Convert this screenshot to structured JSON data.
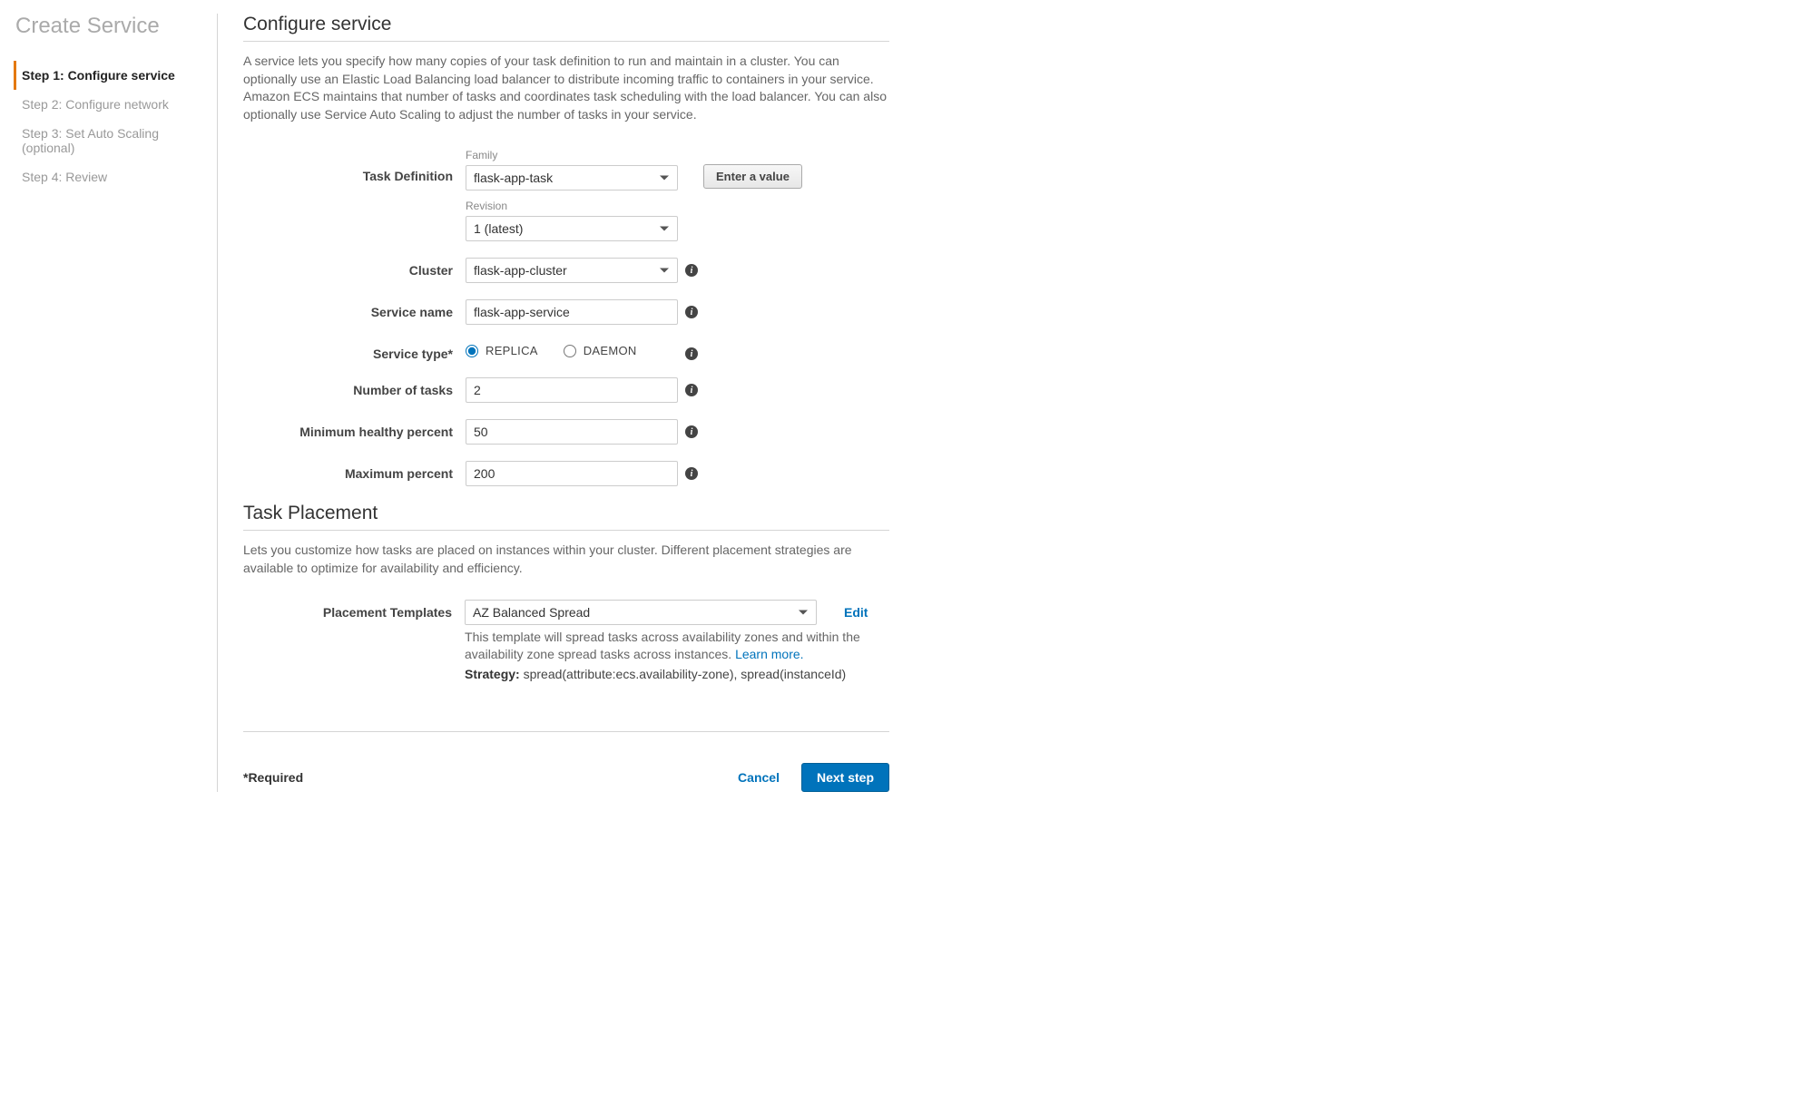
{
  "sidebar": {
    "title": "Create Service",
    "steps": [
      {
        "label": "Step 1: Configure service",
        "active": true
      },
      {
        "label": "Step 2: Configure network",
        "active": false
      },
      {
        "label": "Step 3: Set Auto Scaling (optional)",
        "active": false
      },
      {
        "label": "Step 4: Review",
        "active": false
      }
    ]
  },
  "configure": {
    "title": "Configure service",
    "description": "A service lets you specify how many copies of your task definition to run and maintain in a cluster. You can optionally use an Elastic Load Balancing load balancer to distribute incoming traffic to containers in your service. Amazon ECS maintains that number of tasks and coordinates task scheduling with the load balancer. You can also optionally use Service Auto Scaling to adjust the number of tasks in your service.",
    "task_definition": {
      "label": "Task Definition",
      "family_label": "Family",
      "family_value": "flask-app-task",
      "revision_label": "Revision",
      "revision_value": "1 (latest)",
      "enter_value_btn": "Enter a value"
    },
    "cluster": {
      "label": "Cluster",
      "value": "flask-app-cluster"
    },
    "service_name": {
      "label": "Service name",
      "value": "flask-app-service"
    },
    "service_type": {
      "label": "Service type*",
      "options": [
        {
          "label": "REPLICA",
          "checked": true
        },
        {
          "label": "DAEMON",
          "checked": false
        }
      ]
    },
    "number_of_tasks": {
      "label": "Number of tasks",
      "value": "2"
    },
    "min_healthy": {
      "label": "Minimum healthy percent",
      "value": "50"
    },
    "max_percent": {
      "label": "Maximum percent",
      "value": "200"
    }
  },
  "placement": {
    "title": "Task Placement",
    "description": "Lets you customize how tasks are placed on instances within your cluster. Different placement strategies are available to optimize for availability and efficiency.",
    "templates_label": "Placement Templates",
    "template_value": "AZ Balanced Spread",
    "edit_label": "Edit",
    "template_desc": "This template will spread tasks across availability zones and within the availability zone spread tasks across instances. ",
    "learn_more": "Learn more.",
    "strategy_label": "Strategy:",
    "strategy_value": " spread(attribute:ecs.availability-zone), spread(instanceId)"
  },
  "footer": {
    "required": "*Required",
    "cancel": "Cancel",
    "next": "Next step"
  }
}
